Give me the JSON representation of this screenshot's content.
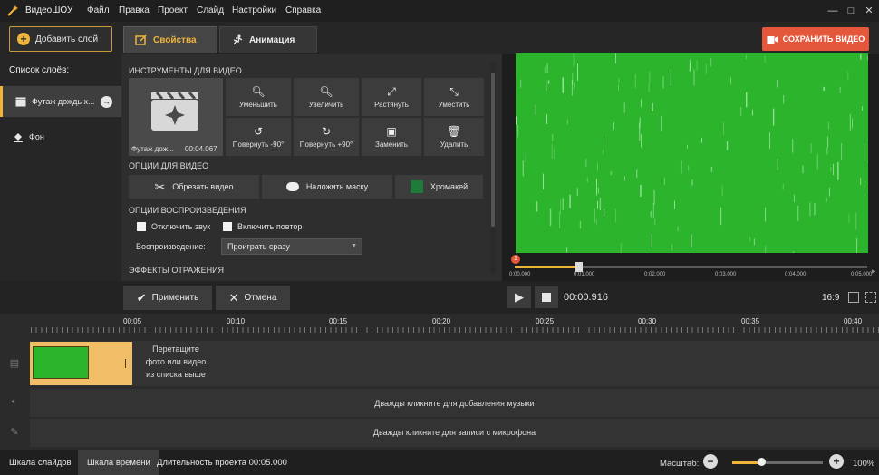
{
  "app": {
    "name": "ВидеоШОУ"
  },
  "menu": [
    "Файл",
    "Правка",
    "Проект",
    "Слайд",
    "Настройки",
    "Справка"
  ],
  "window_controls": {
    "minimize": "—",
    "maximize": "□",
    "close": "✕"
  },
  "toolbar": {
    "add_layer": "Добавить слой",
    "tab_properties": "Свойства",
    "tab_animation": "Анимация",
    "save_video": "СОХРАНИТЬ ВИДЕО"
  },
  "layers": {
    "title": "Список слоёв:",
    "items": [
      {
        "label": "Футаж дождь х...",
        "icon": "film-icon"
      },
      {
        "label": "Фон",
        "icon": "paint-bucket-icon"
      }
    ]
  },
  "video_tools": {
    "title": "ИНСТРУМЕНТЫ ДЛЯ ВИДЕО",
    "clip_name": "Футаж дож...",
    "clip_duration": "00:04.067",
    "buttons": [
      {
        "label": "Уменьшить",
        "icon": "zoom-out-icon"
      },
      {
        "label": "Увеличить",
        "icon": "zoom-in-icon"
      },
      {
        "label": "Растянуть",
        "icon": "expand-icon"
      },
      {
        "label": "Уместить",
        "icon": "fit-icon"
      },
      {
        "label": "Повернуть -90°",
        "icon": "rotate-left-icon"
      },
      {
        "label": "Повернуть +90°",
        "icon": "rotate-right-icon"
      },
      {
        "label": "Заменить",
        "icon": "replace-image-icon"
      },
      {
        "label": "Удалить",
        "icon": "trash-icon"
      }
    ]
  },
  "video_options": {
    "title": "ОПЦИИ ДЛЯ ВИДЕО",
    "crop": "Обрезать видео",
    "mask": "Наложить маску",
    "chromakey": "Хромакей"
  },
  "playback_options": {
    "title": "ОПЦИИ ВОСПРОИЗВЕДЕНИЯ",
    "mute": "Отключить звук",
    "loop": "Включить повтор",
    "playback_label": "Воспроизведение:",
    "playback_value": "Проиграть сразу"
  },
  "reflection": {
    "title": "ЭФФЕКТЫ ОТРАЖЕНИЯ"
  },
  "preview": {
    "marker": "1",
    "timeline_labels": [
      "0:00.000",
      "0:01.000",
      "0:02.000",
      "0:03.000",
      "0:04.000",
      "0:05.000"
    ],
    "progress_fraction": 0.183,
    "timecode": "00:00.916",
    "aspect": "16:9"
  },
  "actions": {
    "apply": "Применить",
    "cancel": "Отмена"
  },
  "ruler": {
    "labels": [
      "00:05",
      "00:10",
      "00:15",
      "00:20",
      "00:25",
      "00:30",
      "00:35",
      "00:40"
    ]
  },
  "tracks": {
    "drop_hint_1": "Перетащите",
    "drop_hint_2": "фото или видео",
    "drop_hint_3": "из списка выше",
    "music": "Дважды кликните для добавления музыки",
    "mic": "Дважды кликните для записи с микрофона"
  },
  "bottom": {
    "tab_slides": "Шкала слайдов",
    "tab_timeline": "Шкала времени",
    "duration": "Длительность проекта 00:05.000",
    "scale_label": "Масштаб:",
    "zoom_percent": "100%",
    "zoom_fraction": 0.32
  },
  "colors": {
    "accent": "#f0b43b",
    "save": "#e5573a",
    "chroma_green": "#2db42d"
  }
}
